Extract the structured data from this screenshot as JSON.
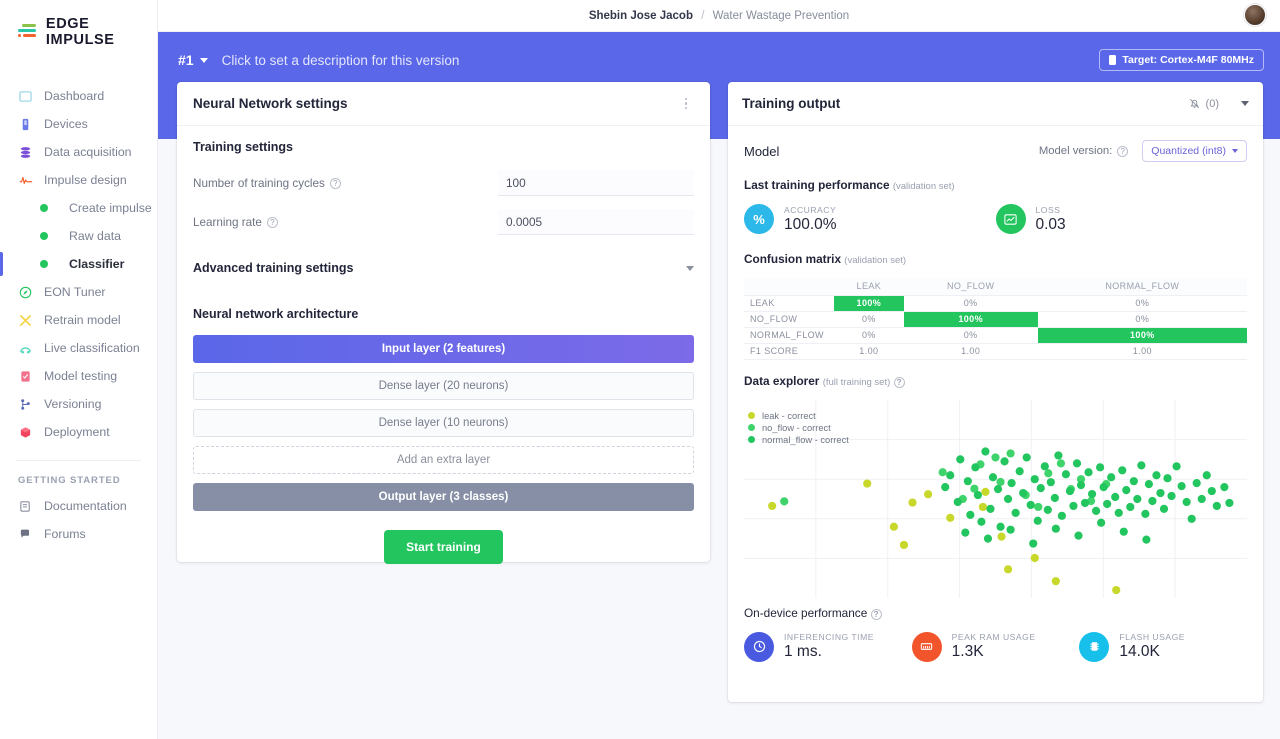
{
  "brand": {
    "name": "EDGE IMPULSE"
  },
  "topbar": {
    "owner": "Shebin Jose Jacob",
    "separator": "/",
    "project": "Water Wastage Prevention"
  },
  "sidebar": {
    "items": [
      {
        "label": "Dashboard",
        "icon": "dashboard-icon"
      },
      {
        "label": "Devices",
        "icon": "devices-icon"
      },
      {
        "label": "Data acquisition",
        "icon": "data-acquisition-icon"
      },
      {
        "label": "Impulse design",
        "icon": "impulse-design-icon"
      }
    ],
    "sub_items": [
      {
        "label": "Create impulse",
        "active": false
      },
      {
        "label": "Raw data",
        "active": false
      },
      {
        "label": "Classifier",
        "active": true
      }
    ],
    "items2": [
      {
        "label": "EON Tuner",
        "icon": "eon-tuner-icon"
      },
      {
        "label": "Retrain model",
        "icon": "retrain-model-icon"
      },
      {
        "label": "Live classification",
        "icon": "live-classification-icon"
      },
      {
        "label": "Model testing",
        "icon": "model-testing-icon"
      },
      {
        "label": "Versioning",
        "icon": "versioning-icon"
      },
      {
        "label": "Deployment",
        "icon": "deployment-icon"
      }
    ],
    "section_label": "GETTING STARTED",
    "footer_items": [
      {
        "label": "Documentation",
        "icon": "documentation-icon"
      },
      {
        "label": "Forums",
        "icon": "forums-icon"
      }
    ]
  },
  "banner": {
    "version": "#1",
    "description": "Click to set a description for this version",
    "target_badge": "Target: Cortex-M4F 80MHz",
    "color": "#5a67e8"
  },
  "nn_settings": {
    "title": "Neural Network settings",
    "training_settings_title": "Training settings",
    "cycles_label": "Number of training cycles",
    "cycles_value": "100",
    "learning_rate_label": "Learning rate",
    "learning_rate_value": "0.0005",
    "advanced_title": "Advanced training settings",
    "architecture_title": "Neural network architecture",
    "layers": [
      {
        "label": "Input layer (2 features)",
        "kind": "input"
      },
      {
        "label": "Dense layer (20 neurons)",
        "kind": "dense"
      },
      {
        "label": "Dense layer (10 neurons)",
        "kind": "dense"
      },
      {
        "label": "Add an extra layer",
        "kind": "add"
      },
      {
        "label": "Output layer (3 classes)",
        "kind": "output"
      }
    ],
    "start_training_label": "Start training"
  },
  "training_output": {
    "title": "Training output",
    "notification_count": "(0)",
    "model_title": "Model",
    "model_version_label": "Model version:",
    "model_version_value": "Quantized (int8)",
    "last_training_title": "Last training performance",
    "last_training_note": "(validation set)",
    "metrics": [
      {
        "key": "ACCURACY",
        "value": "100.0%",
        "icon": "percent-icon",
        "color": "#2cb8e8"
      },
      {
        "key": "LOSS",
        "value": "0.03",
        "icon": "chart-icon",
        "color": "#22c55e"
      }
    ],
    "confusion_title": "Confusion matrix",
    "confusion_note": "(validation set)",
    "data_explorer_title": "Data explorer",
    "data_explorer_note": "(full training set)",
    "on_device_title": "On-device performance",
    "device_metrics": [
      {
        "key": "INFERENCING TIME",
        "value": "1 ms.",
        "icon": "clock-icon",
        "color": "#4a5ae0"
      },
      {
        "key": "PEAK RAM USAGE",
        "value": "1.3K",
        "icon": "ram-icon",
        "color": "#f2552c"
      },
      {
        "key": "FLASH USAGE",
        "value": "14.0K",
        "icon": "flash-icon",
        "color": "#17c0eb"
      }
    ]
  },
  "chart_data": [
    {
      "type": "table",
      "title": "Confusion matrix (validation set)",
      "columns": [
        "",
        "LEAK",
        "NO_FLOW",
        "NORMAL_FLOW"
      ],
      "rows": [
        {
          "label": "LEAK",
          "cells": [
            "100%",
            "0%",
            "0%"
          ],
          "highlight": 0
        },
        {
          "label": "NO_FLOW",
          "cells": [
            "0%",
            "100%",
            "0%"
          ],
          "highlight": 1
        },
        {
          "label": "NORMAL_FLOW",
          "cells": [
            "0%",
            "0%",
            "100%"
          ],
          "highlight": 2
        },
        {
          "label": "F1 SCORE",
          "cells": [
            "1.00",
            "1.00",
            "1.00"
          ],
          "highlight": -1
        }
      ]
    },
    {
      "type": "scatter",
      "title": "Data explorer (full training set)",
      "xlabel": "",
      "ylabel": "",
      "xlim": [
        0,
        100
      ],
      "ylim": [
        0,
        100
      ],
      "grid": true,
      "legend_position": "top-left",
      "series": [
        {
          "name": "leak - correct",
          "color": "#c8d82a",
          "points": [
            [
              5.6,
              46.5
            ],
            [
              24.5,
              57.8
            ],
            [
              29.8,
              36.0
            ],
            [
              31.8,
              26.8
            ],
            [
              33.5,
              48.2
            ],
            [
              36.6,
              52.4
            ],
            [
              41.0,
              40.5
            ],
            [
              47.5,
              46.0
            ],
            [
              48.0,
              53.6
            ],
            [
              51.2,
              31.0
            ],
            [
              52.5,
              14.5
            ],
            [
              57.8,
              20.2
            ],
            [
              62.0,
              8.5
            ],
            [
              74.0,
              4.0
            ]
          ]
        },
        {
          "name": "no_flow - correct",
          "color": "#3fd46b",
          "points": [
            [
              8.0,
              48.8
            ],
            [
              39.5,
              63.5
            ],
            [
              43.5,
              50.0
            ],
            [
              45.8,
              55.2
            ],
            [
              47.0,
              67.5
            ],
            [
              50.0,
              71.0
            ],
            [
              51.0,
              58.6
            ],
            [
              53.0,
              73.0
            ],
            [
              56.0,
              52.0
            ],
            [
              58.5,
              46.0
            ],
            [
              60.5,
              63.0
            ],
            [
              63.0,
              68.0
            ],
            [
              65.0,
              55.0
            ],
            [
              67.0,
              60.0
            ],
            [
              69.0,
              49.0
            ],
            [
              72.0,
              57.5
            ]
          ]
        },
        {
          "name": "normal_flow - correct",
          "color": "#22c55e",
          "points": [
            [
              40.0,
              56.0
            ],
            [
              41.0,
              62.0
            ],
            [
              42.5,
              48.5
            ],
            [
              43.0,
              70.0
            ],
            [
              44.5,
              59.0
            ],
            [
              45.0,
              42.0
            ],
            [
              46.0,
              66.0
            ],
            [
              46.5,
              52.0
            ],
            [
              47.2,
              38.5
            ],
            [
              48.0,
              74.0
            ],
            [
              49.0,
              45.0
            ],
            [
              49.5,
              61.0
            ],
            [
              50.5,
              55.0
            ],
            [
              51.0,
              36.0
            ],
            [
              51.8,
              69.0
            ],
            [
              52.5,
              50.0
            ],
            [
              53.2,
              58.0
            ],
            [
              54.0,
              43.0
            ],
            [
              54.8,
              64.0
            ],
            [
              55.5,
              53.0
            ],
            [
              56.2,
              71.0
            ],
            [
              57.0,
              47.0
            ],
            [
              57.8,
              60.0
            ],
            [
              58.4,
              39.0
            ],
            [
              59.0,
              55.5
            ],
            [
              59.8,
              66.5
            ],
            [
              60.4,
              44.5
            ],
            [
              61.0,
              58.5
            ],
            [
              61.8,
              50.5
            ],
            [
              62.5,
              72.0
            ],
            [
              63.2,
              41.5
            ],
            [
              64.0,
              62.5
            ],
            [
              64.8,
              54.0
            ],
            [
              65.5,
              46.5
            ],
            [
              66.2,
              68.0
            ],
            [
              67.0,
              57.0
            ],
            [
              67.8,
              48.0
            ],
            [
              68.5,
              63.5
            ],
            [
              69.2,
              52.5
            ],
            [
              70.0,
              44.0
            ],
            [
              70.8,
              66.0
            ],
            [
              71.5,
              56.0
            ],
            [
              72.2,
              47.5
            ],
            [
              73.0,
              61.0
            ],
            [
              73.8,
              51.0
            ],
            [
              74.5,
              43.0
            ],
            [
              75.2,
              64.5
            ],
            [
              76.0,
              54.5
            ],
            [
              76.8,
              46.0
            ],
            [
              77.5,
              59.0
            ],
            [
              78.2,
              50.0
            ],
            [
              79.0,
              67.0
            ],
            [
              79.8,
              42.5
            ],
            [
              80.5,
              57.5
            ],
            [
              81.2,
              49.0
            ],
            [
              82.0,
              62.0
            ],
            [
              82.8,
              53.0
            ],
            [
              83.5,
              45.0
            ],
            [
              84.2,
              60.5
            ],
            [
              85.0,
              51.5
            ],
            [
              86.0,
              66.5
            ],
            [
              87.0,
              56.5
            ],
            [
              88.0,
              48.5
            ],
            [
              89.0,
              40.0
            ],
            [
              90.0,
              58.0
            ],
            [
              91.0,
              50.0
            ],
            [
              92.0,
              62.0
            ],
            [
              93.0,
              54.0
            ],
            [
              94.0,
              46.5
            ],
            [
              95.5,
              56.0
            ],
            [
              96.5,
              48.0
            ],
            [
              44.0,
              33.0
            ],
            [
              48.5,
              30.0
            ],
            [
              53.0,
              34.5
            ],
            [
              57.5,
              27.5
            ],
            [
              62.0,
              35.0
            ],
            [
              66.5,
              31.5
            ],
            [
              71.0,
              38.0
            ],
            [
              75.5,
              33.5
            ],
            [
              80.0,
              29.5
            ]
          ]
        }
      ]
    }
  ]
}
